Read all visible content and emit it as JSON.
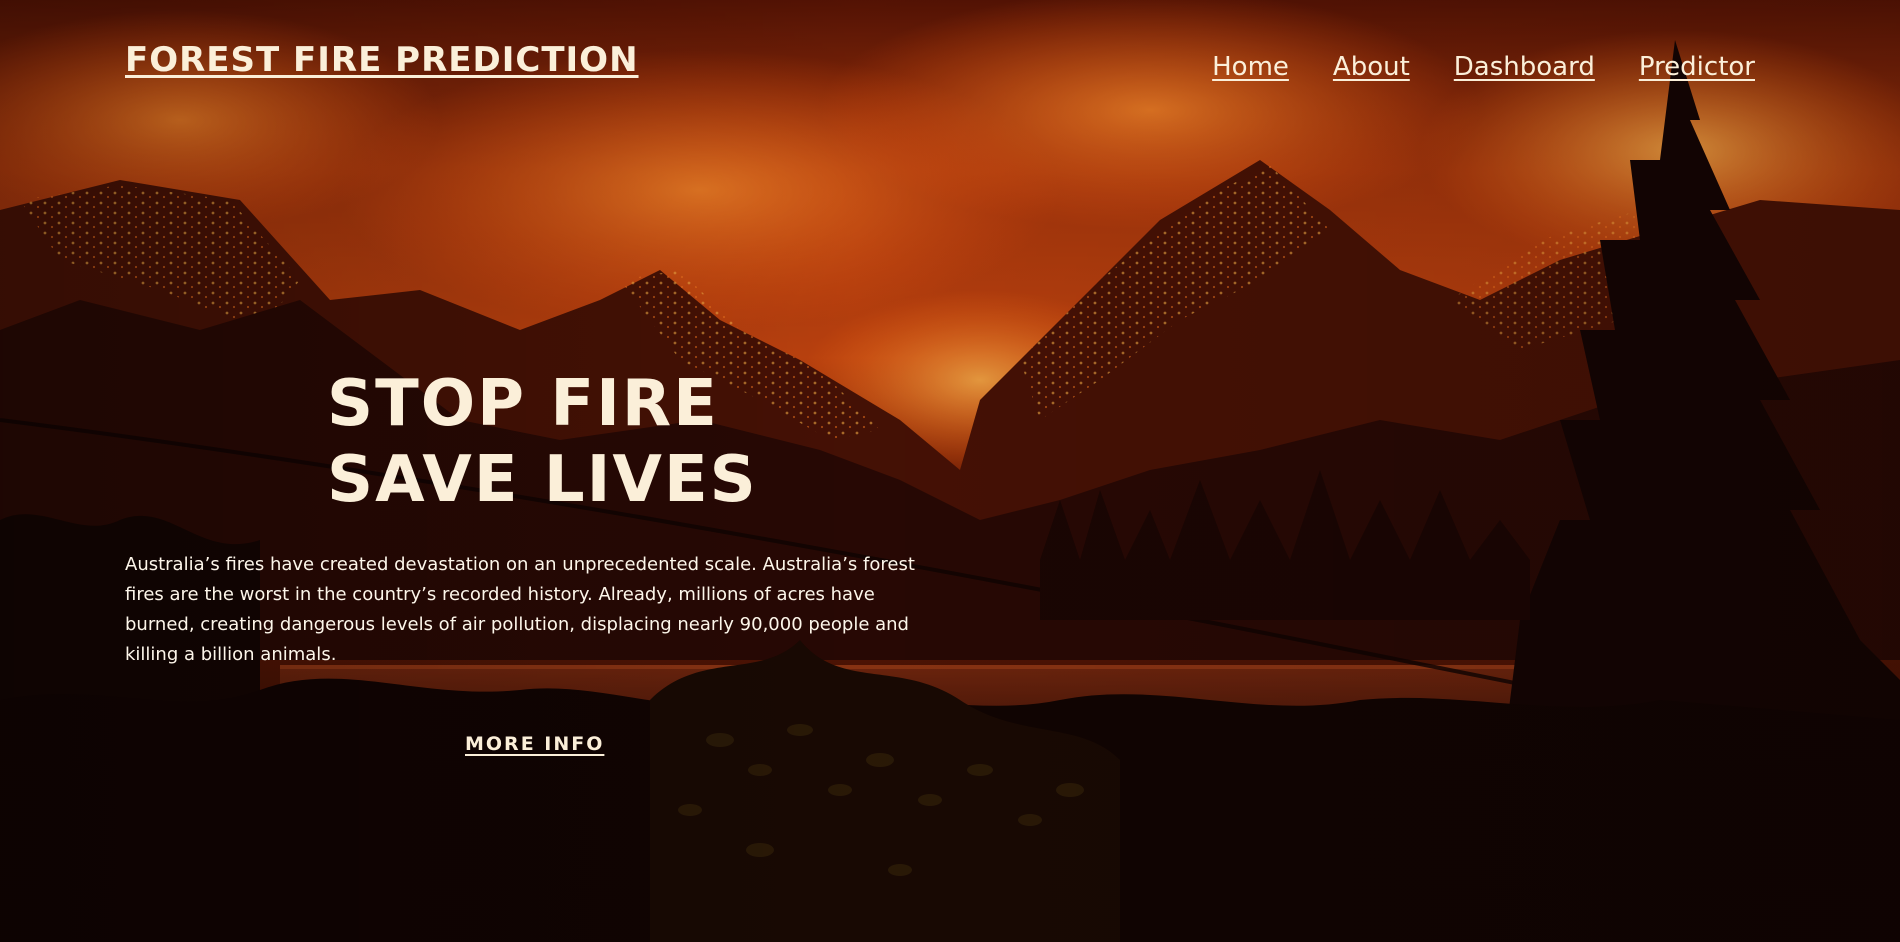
{
  "header": {
    "site_title": "FOREST FIRE PREDICTION",
    "nav": [
      {
        "label": "Home"
      },
      {
        "label": "About"
      },
      {
        "label": "Dashboard"
      },
      {
        "label": "Predictor"
      }
    ]
  },
  "hero": {
    "heading_line1": "STOP FIRE",
    "heading_line2": "SAVE LIVES",
    "description": "Australia’s fires have created devastation on an unprecedented scale. Australia’s forest fires are the worst in the country’s recorded history. Already, millions of acres have burned, creating dangerous levels of air pollution, displacing nearly 90,000 people and killing a billion animals.",
    "cta_label": "MORE INFO"
  },
  "background": {
    "image": "forest-fire-mountains-photo"
  },
  "colors": {
    "text": "#fbefd9",
    "sky_glow": "#e8531a",
    "ember": "#ffb347",
    "smoke": "#7a2006",
    "silhouette": "#130503"
  }
}
